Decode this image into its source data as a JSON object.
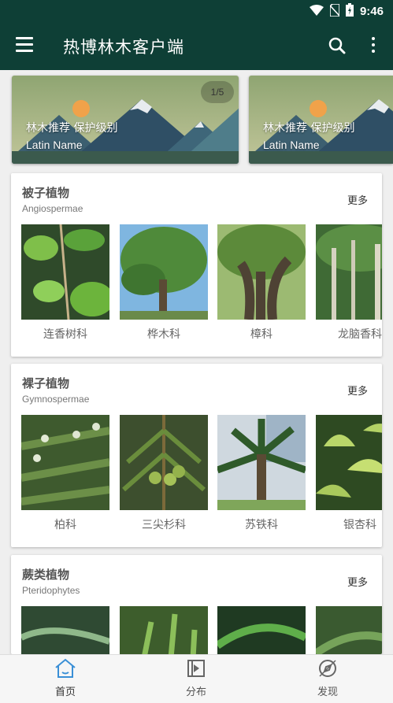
{
  "status_bar": {
    "time": "9:46"
  },
  "app_bar": {
    "title": "热博林木客户端"
  },
  "banners": [
    {
      "line1": "林木推荐  保护级别",
      "line2": "Latin Name",
      "pager": "1/5"
    },
    {
      "line1": "林木推荐  保护级别",
      "line2": "Latin Name"
    }
  ],
  "sections": [
    {
      "title": "被子植物",
      "subtitle": "Angiospermae",
      "more": "更多",
      "items": [
        {
          "label": "连香树科"
        },
        {
          "label": "桦木科"
        },
        {
          "label": "樟科"
        },
        {
          "label": "龙脑香科"
        }
      ]
    },
    {
      "title": "裸子植物",
      "subtitle": "Gymnospermae",
      "more": "更多",
      "items": [
        {
          "label": "柏科"
        },
        {
          "label": "三尖杉科"
        },
        {
          "label": "苏铁科"
        },
        {
          "label": "银杏科"
        }
      ]
    },
    {
      "title": "蕨类植物",
      "subtitle": "Pteridophytes",
      "more": "更多",
      "items": [
        {},
        {},
        {},
        {}
      ]
    }
  ],
  "bottom_nav": [
    {
      "label": "首页",
      "icon": "home-icon",
      "active": true
    },
    {
      "label": "分布",
      "icon": "play-square-icon"
    },
    {
      "label": "发现",
      "icon": "compass-icon"
    }
  ],
  "colors": {
    "primary": "#0e3f36",
    "nav_active": "#3a8fd6",
    "nav_inactive": "#555555"
  }
}
